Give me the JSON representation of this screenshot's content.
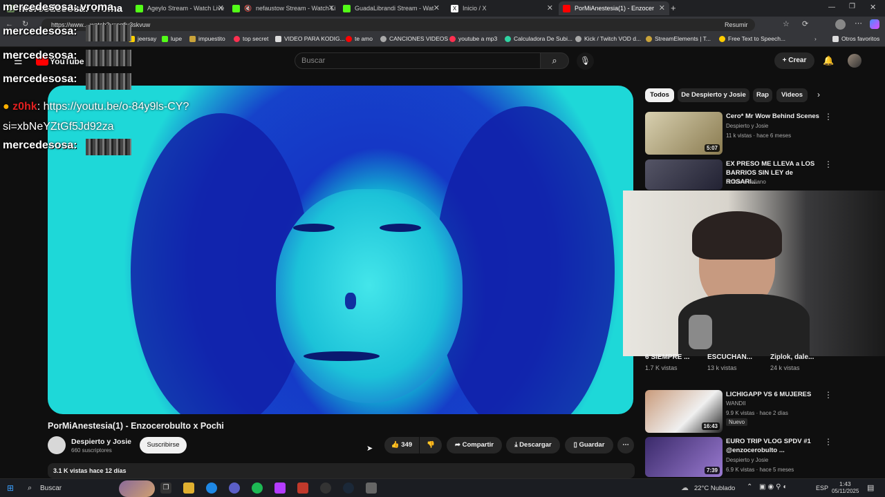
{
  "browser": {
    "tabs": [
      {
        "label": "mercedesosa: vroma"
      },
      {
        "label": "Ageylo Stream - Watch Live"
      },
      {
        "label": "nefaustow Stream - Watch Li"
      },
      {
        "label": "GuadaLibrandi Stream - Wat"
      },
      {
        "label": "Inicio / X"
      },
      {
        "label": "PorMiAnestesia(1) - Enzocer"
      }
    ],
    "url": "https://www... watch?v=nqfiv3skvuw",
    "resumir": "Resumir",
    "bookmarks": [
      "jeersay",
      "lupe",
      "impuestito",
      "top secret",
      "VIDEO PARA KODIG...",
      "te amo",
      "CANCIONES VIDEOS",
      "youtube a mp3",
      "Calculadora De Subi...",
      "Kick / Twitch VOD d...",
      "StreamElements | T...",
      "Free Text to Speech...",
      "Otros favoritos"
    ]
  },
  "youtube": {
    "logo": "YouTube",
    "search_placeholder": "Buscar",
    "create_label": "Crear",
    "chips": [
      "Todos",
      "De Despierto y Josie",
      "Rap",
      "Videos"
    ],
    "video": {
      "title": "PorMiAnestesia(1) - Enzocerobulto x Pochi",
      "channel": "Despierto y Josie",
      "subscribers": "660 suscriptores",
      "subscribe_label": "Suscribirse",
      "likes": "349",
      "share_label": "Compartir",
      "download_label": "Descargar",
      "save_label": "Guardar",
      "views_date": "3.1 K vistas  hace 12 días"
    },
    "recommendations": [
      {
        "title": "Cero* Mr Wow Behind Scenes",
        "channel": "Despierto y Josie",
        "meta": "11 k vistas · hace 6 meses",
        "duration": "5:07"
      },
      {
        "title": "EX PRESO ME LLEVA a LOS BARRIOS SIN LEY de ROSARI...",
        "channel": "Zazza el italiano"
      },
      {
        "title": "LICHIGAPP VS 6 MUJERES",
        "channel": "WANDII",
        "meta": "9.9 K vistas · hace 2 días",
        "badge": "Nuevo",
        "duration": "16:43"
      },
      {
        "title": "EURO TRIP VLOG SPDV #1 @enzocerobulto ...",
        "channel": "Despierto y Josie",
        "meta": "6.9 K vistas · hace 5 meses",
        "duration": "7:39"
      }
    ],
    "shorts": [
      {
        "title": "6 SIEMPRE ...",
        "meta": "1.7 K vistas"
      },
      {
        "title": "ESCUCHAN...",
        "meta": "13 k vistas"
      },
      {
        "title": "Ziplok, dale...",
        "meta": "24 k vistas"
      }
    ]
  },
  "overlay_chat": {
    "lines": [
      "mercedesosa:",
      "mercedesosa:",
      "mercedesosa:",
      "mercedesosa:"
    ],
    "user": "z0hk",
    "link": ": https://youtu.be/o-84y9ls-CY?",
    "link2": "si=xbNeYZtGf5Jd92za",
    "top_name": "mercedesosa: vroma"
  },
  "taskbar": {
    "search": "Buscar",
    "weather": "22°C  Nublado",
    "lang": "ESP",
    "time": "1:43",
    "date": "05/11/2025"
  },
  "colors": {
    "yt_red": "#ff0000",
    "bg": "#0f0f0f"
  }
}
